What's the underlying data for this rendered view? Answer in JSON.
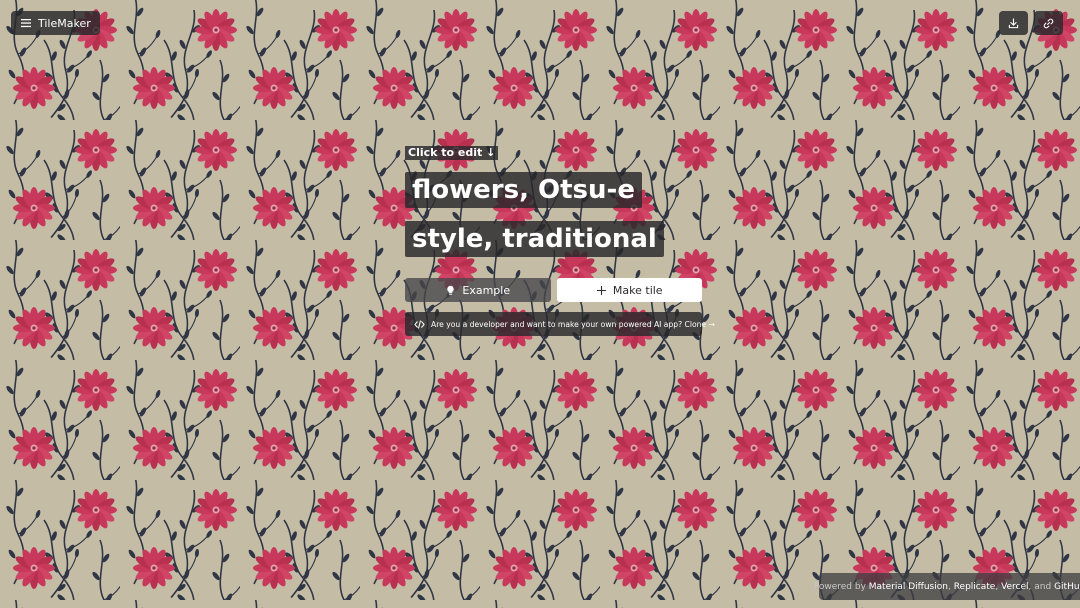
{
  "app": {
    "title": "TileMaker"
  },
  "icons": {
    "menu": "hamburger-menu-icon",
    "download": "download-icon",
    "link": "link-icon",
    "example": "lightbulb-icon",
    "make_tile": "plus-icon",
    "code": "code-icon"
  },
  "editor": {
    "hint": "Click to edit ↓",
    "prompt_line_1": "flowers, Otsu-e",
    "prompt_line_2": "style, traditional"
  },
  "actions": {
    "example_label": "Example",
    "make_tile_label": "Make tile"
  },
  "dev_banner": {
    "text": "Are you a developer and want to make your own powered AI app? Clone →"
  },
  "footer": {
    "prefix": "Powered by ",
    "link_1": "Material Diffusion",
    "sep_1": ", ",
    "link_2": "Replicate",
    "sep_2": ", ",
    "link_3": "Vercel",
    "sep_3": ", and ",
    "link_4": "GitHub"
  },
  "colors": {
    "background": "#c4bca5",
    "flower": "#c8385a",
    "flower_center": "#e8a0b0",
    "vine": "#2f3645",
    "chip": "#28282c"
  }
}
